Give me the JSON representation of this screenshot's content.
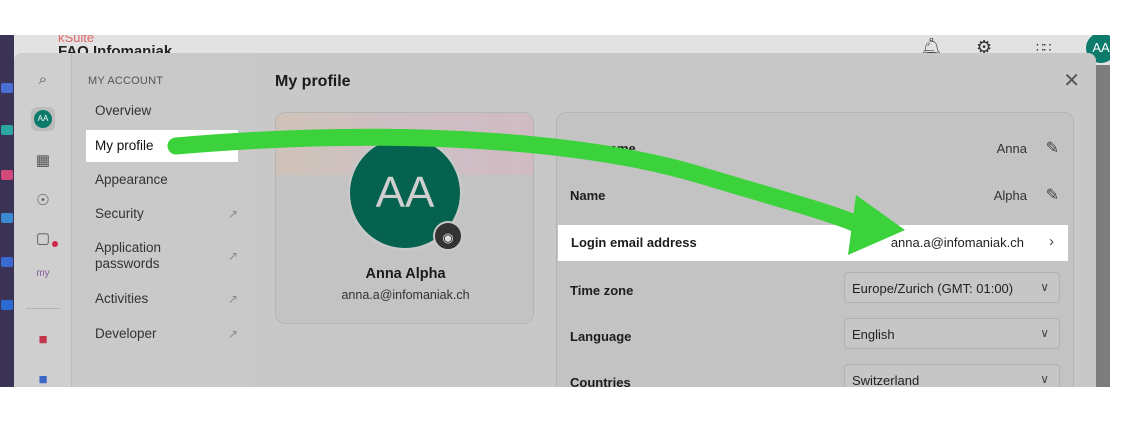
{
  "topbar": {
    "brand": "kSuite",
    "app_name": "FAQ Infomaniak",
    "user_initials": "AA"
  },
  "sidebar": {
    "section_title": "MY ACCOUNT",
    "items": [
      {
        "label": "Overview",
        "external": false
      },
      {
        "label": "My profile",
        "external": false,
        "active": true
      },
      {
        "label": "Appearance",
        "external": false
      },
      {
        "label": "Security",
        "external": true
      },
      {
        "label": "Application passwords",
        "external": true
      },
      {
        "label": "Activities",
        "external": true
      },
      {
        "label": "Developer",
        "external": true
      }
    ],
    "avatar_initials": "AA"
  },
  "content": {
    "title": "My profile",
    "close_icon": "close-icon",
    "profile_card": {
      "initials": "AA",
      "name": "Anna Alpha",
      "email": "anna.a@infomaniak.ch"
    },
    "fields": {
      "first_name": {
        "label": "First name",
        "value": "Anna"
      },
      "name": {
        "label": "Name",
        "value": "Alpha"
      },
      "login_email": {
        "label": "Login email address",
        "value": "anna.a@infomaniak.ch"
      },
      "time_zone": {
        "label": "Time zone",
        "value": "Europe/Zurich (GMT: 01:00)"
      },
      "language": {
        "label": "Language",
        "value": "English"
      },
      "countries": {
        "label": "Countries",
        "value": "Switzerland"
      }
    }
  },
  "colors": {
    "accent_green": "#3cd23c",
    "avatar_teal": "#0d7b6b",
    "notification_red": "#d3244b"
  }
}
